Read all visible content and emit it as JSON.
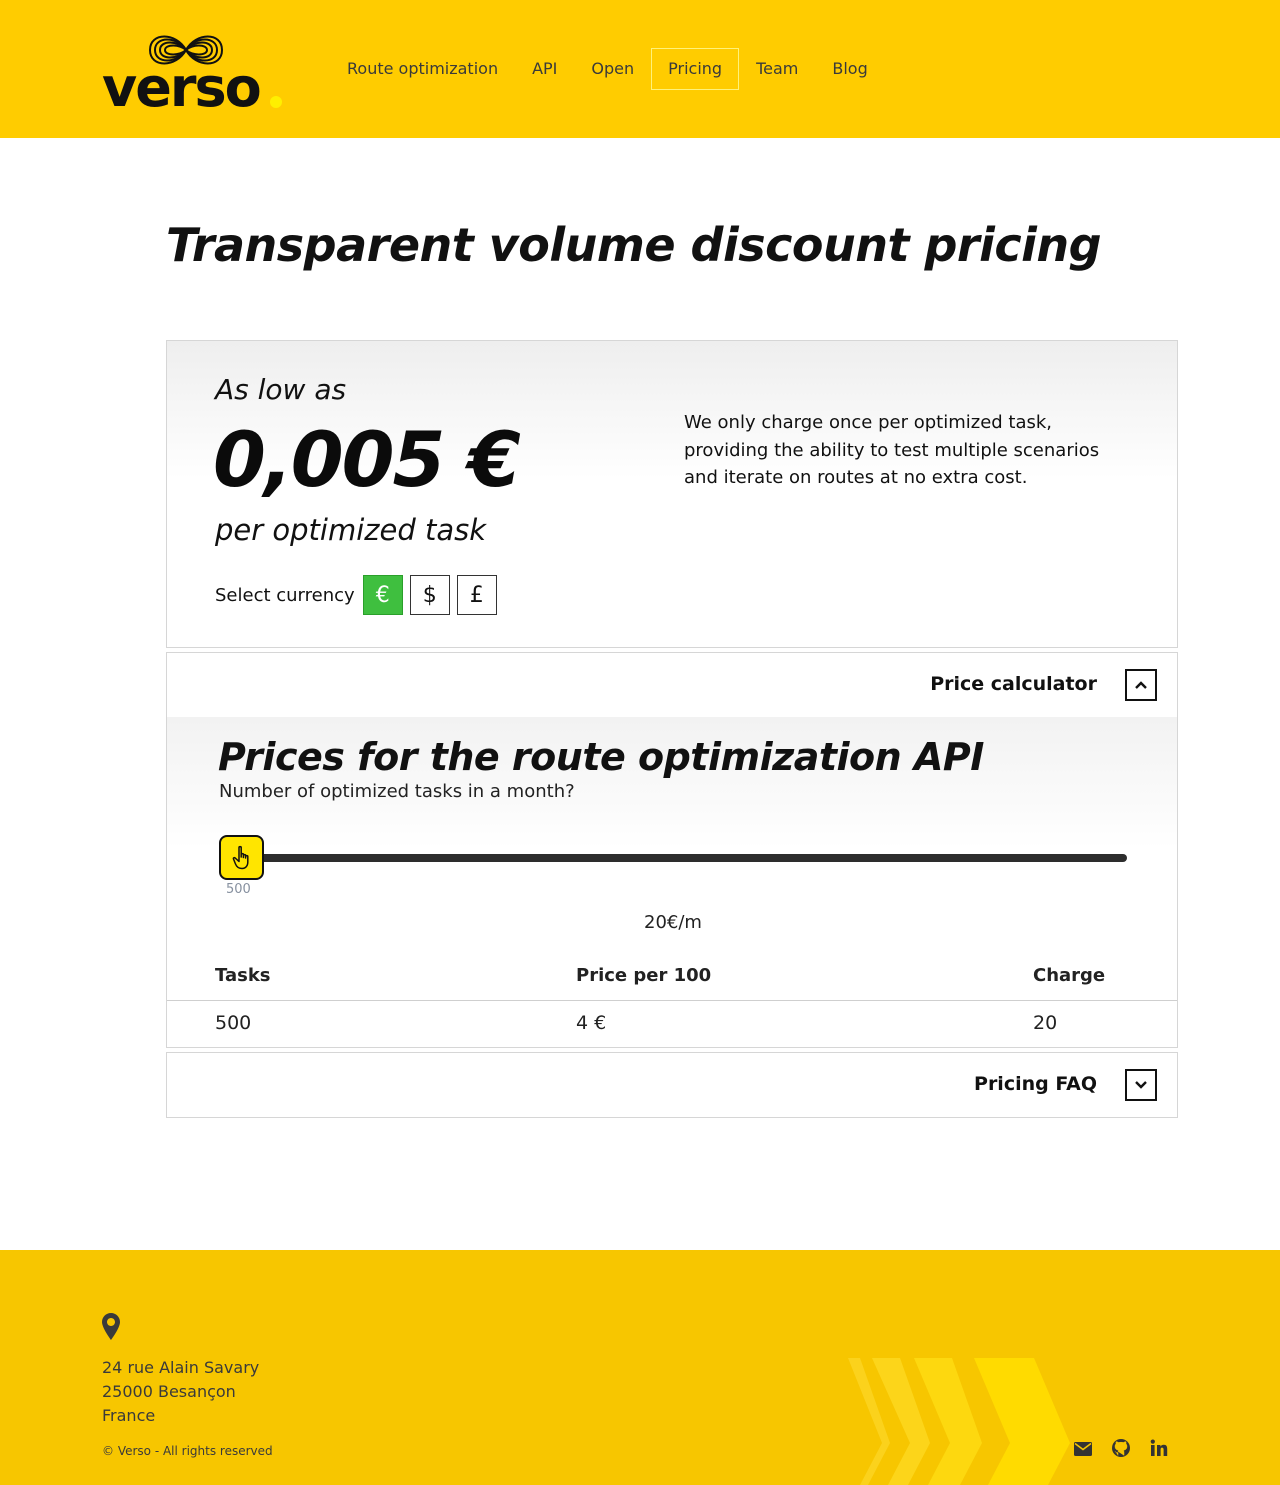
{
  "header": {
    "logo_text": "verso",
    "nav": [
      {
        "label": "Route optimization",
        "active": false
      },
      {
        "label": "API",
        "active": false
      },
      {
        "label": "Open",
        "active": false
      },
      {
        "label": "Pricing",
        "active": true
      },
      {
        "label": "Team",
        "active": false
      },
      {
        "label": "Blog",
        "active": false
      }
    ]
  },
  "page_title": "Transparent volume discount pricing",
  "summary": {
    "as_low_as": "As low as",
    "price": "0,005 €",
    "per_task": "per optimized task",
    "currency_label": "Select currency",
    "currencies": [
      "€",
      "$",
      "£"
    ],
    "selected_currency": "€",
    "description": "We only charge once per optimized task, providing the ability to test multiple scenarios and iterate on routes at no extra cost."
  },
  "calculator": {
    "toggle_label": "Price calculator",
    "expanded": true,
    "title": "Prices for the route optimization API",
    "question": "Number of optimized tasks in a month?",
    "slider_value": "500",
    "monthly_total": "20€/m",
    "columns": [
      "Tasks",
      "Price per 100",
      "Charge"
    ],
    "row": [
      "500",
      "4 €",
      "20"
    ]
  },
  "faq": {
    "toggle_label": "Pricing FAQ",
    "expanded": false
  },
  "footer": {
    "address": [
      "24 rue Alain Savary",
      "25000 Besançon",
      "France"
    ],
    "copyright": "© Verso - All rights reserved",
    "social_icons": [
      "email-icon",
      "github-icon",
      "linkedin-icon"
    ]
  },
  "colors": {
    "brand_yellow": "#ffcc00",
    "footer_yellow": "#f7c600",
    "active_currency": "#3fbf3f",
    "slider_handle": "#ffe500"
  }
}
